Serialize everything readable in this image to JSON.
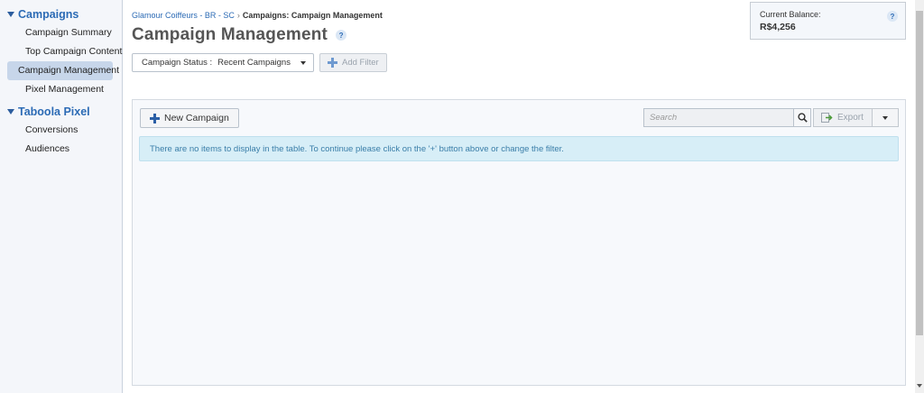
{
  "sidebar": {
    "sections": [
      {
        "title": "Campaigns",
        "items": [
          {
            "label": "Campaign Summary"
          },
          {
            "label": "Top Campaign Content"
          },
          {
            "label": "Campaign Management"
          },
          {
            "label": "Pixel Management"
          }
        ]
      },
      {
        "title": "Taboola Pixel",
        "items": [
          {
            "label": "Conversions"
          },
          {
            "label": "Audiences"
          }
        ]
      }
    ]
  },
  "breadcrumb": {
    "account": "Glamour Coiffeurs - BR - SC",
    "separator": "›",
    "current": "Campaigns: Campaign Management"
  },
  "header": {
    "title": "Campaign Management",
    "help": "?"
  },
  "filters": {
    "status_label": "Campaign Status :",
    "status_value": "Recent Campaigns",
    "add_filter_label": "Add Filter"
  },
  "balance": {
    "label": "Current Balance:",
    "value": "R$4,256",
    "help": "?"
  },
  "toolbar": {
    "new_campaign_label": "New Campaign",
    "search_placeholder": "Search",
    "export_label": "Export"
  },
  "table": {
    "empty_message": "There are no items to display in the table. To continue please click on the '+' button above or change the filter."
  },
  "colors": {
    "accent": "#2c6bb5",
    "active_nav": "#c7d6ea",
    "info_bg": "#d7eef7"
  },
  "icons": {
    "add": "plus-icon",
    "search": "search-icon",
    "export": "export-icon",
    "help": "help-icon",
    "caret": "caret-down-icon"
  }
}
